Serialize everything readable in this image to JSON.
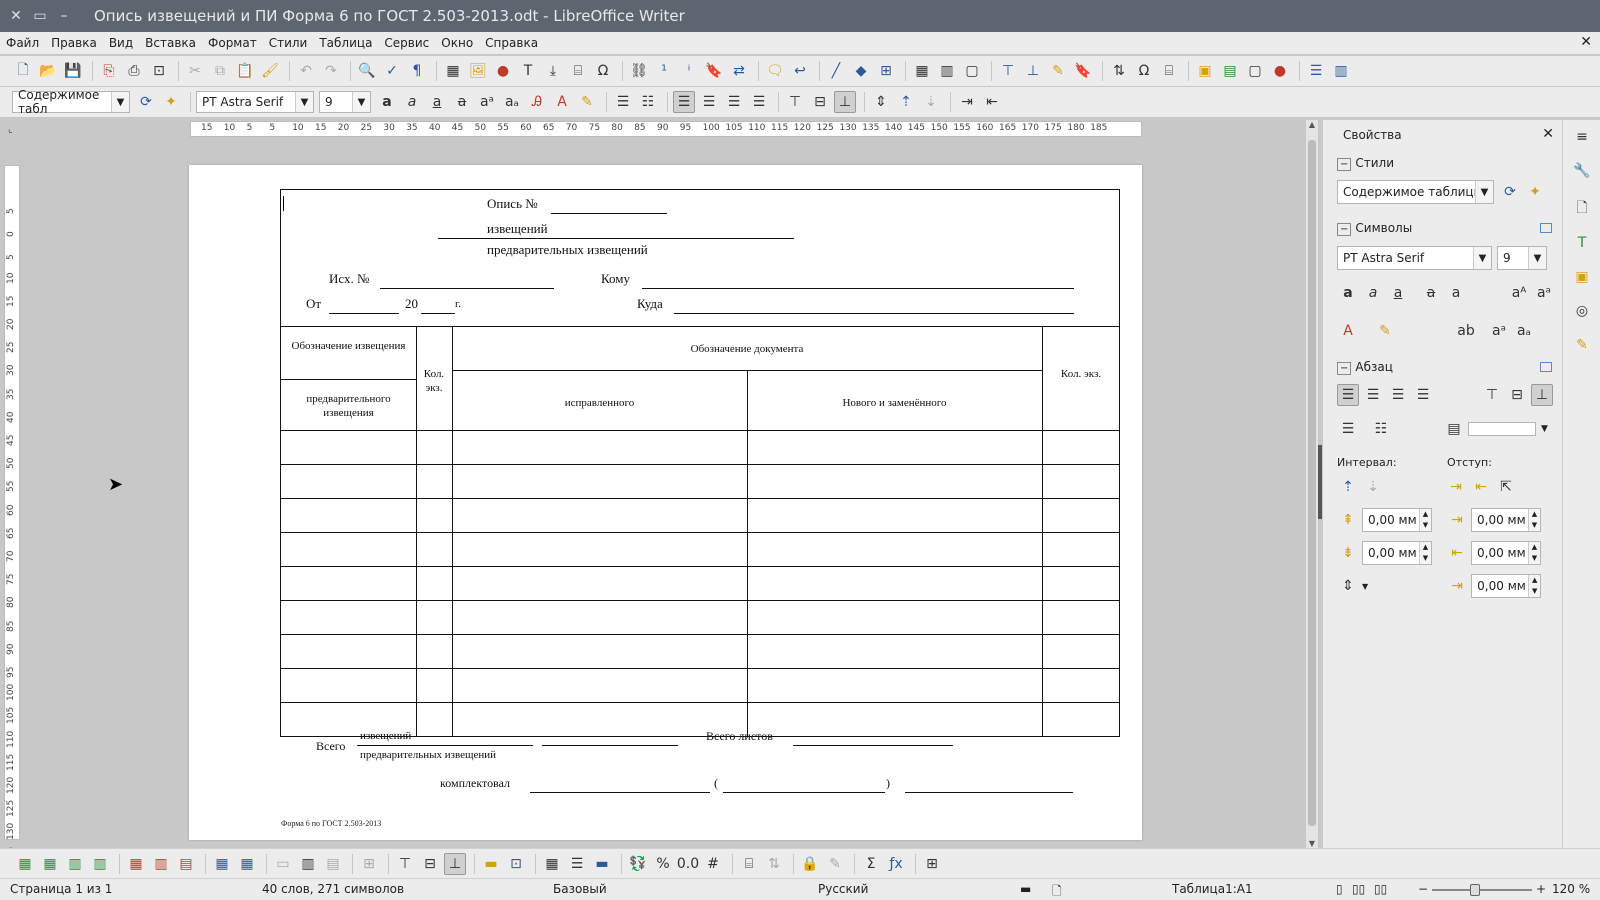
{
  "window": {
    "title": "Опись извещений и ПИ Форма 6 по ГОСТ 2.503-2013.odt - LibreOffice Writer",
    "close": "✕",
    "minimize": "–"
  },
  "menu": [
    "Файл",
    "Правка",
    "Вид",
    "Вставка",
    "Формат",
    "Стили",
    "Таблица",
    "Сервис",
    "Окно",
    "Справка"
  ],
  "formatting": {
    "paragraph_style": "Содержимое табл",
    "font_name": "PT Astra Serif",
    "font_size": "9"
  },
  "ruler": {
    "horizontal_ticks": [
      "15",
      "10",
      "5",
      "5",
      "10",
      "15",
      "20",
      "25",
      "30",
      "35",
      "40",
      "45",
      "50",
      "55",
      "60",
      "65",
      "70",
      "75",
      "80",
      "85",
      "90",
      "95",
      "100",
      "105",
      "110",
      "115",
      "120",
      "125",
      "130",
      "135",
      "140",
      "145",
      "150",
      "155",
      "160",
      "165",
      "170",
      "175",
      "180",
      "185"
    ],
    "vertical_ticks": [
      "5",
      "0",
      "5",
      "10",
      "15",
      "20",
      "25",
      "30",
      "35",
      "40",
      "45",
      "50",
      "55",
      "60",
      "65",
      "70",
      "75",
      "80",
      "85",
      "90",
      "95",
      "100",
      "105",
      "110",
      "115",
      "120",
      "125",
      "130",
      "135",
      "140"
    ]
  },
  "document": {
    "opis_label": "Опись №",
    "izv_label": "извещений",
    "pred_izv_label": "предварительных извещений",
    "isx_label": "Исх. №",
    "komu_label": "Кому",
    "ot_label": "От",
    "year_prefix": "20",
    "year_suffix": "г.",
    "kuda_label": "Куда",
    "table": {
      "h_oboz_izv": "Обозначение извещения",
      "h_pred_izv": "предварительного извещения",
      "h_kol_1": "Кол. экз.",
      "h_oboz_doc": "Обозначение документа",
      "h_ispravl": "исправленного",
      "h_novogo": "Нового и заменённого",
      "h_kol_2": "Кол. экз.",
      "empty_rows": 9
    },
    "vsego_label": "Всего",
    "vsego_izv": "извещений",
    "vsego_pred": "предварительных извещений",
    "vsego_listov": "Всего листов",
    "komplektoval": "комплектовал",
    "paren_open": "(",
    "paren_close": ")",
    "footer_note": "Форма 6 по ГОСТ 2.503-2013"
  },
  "sidebar": {
    "title": "Свойства",
    "styles_section": "Стили",
    "style_value": "Содержимое таблицы",
    "chars_section": "Символы",
    "font_value": "PT Astra Serif",
    "size_value": "9",
    "para_section": "Абзац",
    "interval_label": "Интервал:",
    "indent_label": "Отступ:",
    "spacing_above": "0,00 мм",
    "spacing_below": "0,00 мм",
    "indent_before": "0,00 мм",
    "indent_after": "0,00 мм",
    "indent_first": "0,00 мм"
  },
  "status": {
    "page": "Страница 1 из 1",
    "words": "40 слов, 271 символов",
    "page_style": "Базовый",
    "language": "Русский",
    "cell": "Таблица1:A1",
    "zoom": "120 %"
  },
  "colors": {
    "titlebar": "#5d6670",
    "toolbar": "#ececec",
    "accent": "#2a5a9c"
  }
}
